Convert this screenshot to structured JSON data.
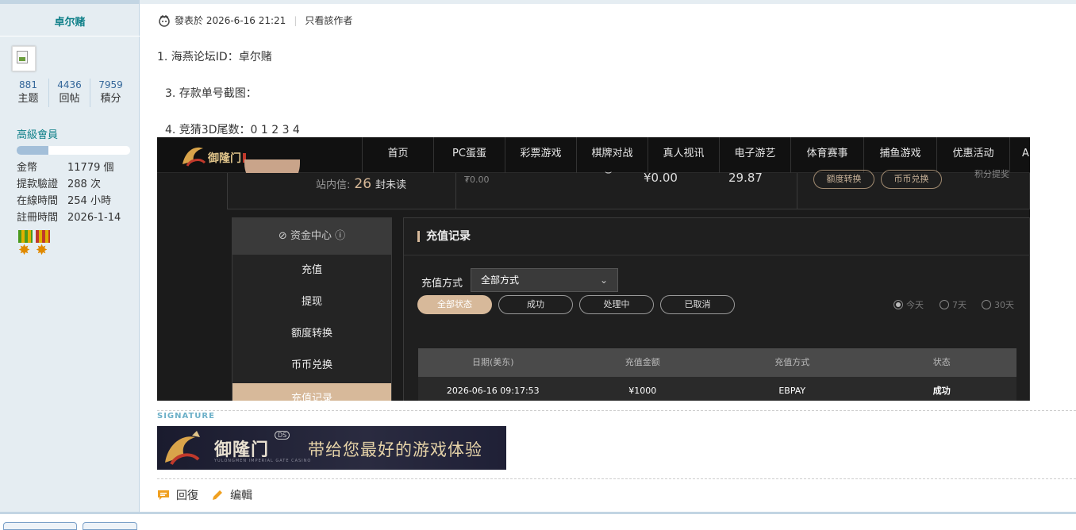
{
  "sidebar": {
    "username": "卓尔赌",
    "stats": [
      {
        "num": "881",
        "label": "主题"
      },
      {
        "num": "4436",
        "label": "回帖"
      },
      {
        "num": "7959",
        "label": "積分"
      }
    ],
    "rank": "高級會員",
    "rank_progress": 0.28,
    "info": [
      {
        "key": "金幣",
        "value": "11779 個"
      },
      {
        "key": "提款驗證",
        "value": "288 次"
      },
      {
        "key": "在線時間",
        "value": "254 小時"
      },
      {
        "key": "註冊時間",
        "value": "2026-1-14"
      }
    ]
  },
  "post": {
    "posted_label": "發表於 2026-6-16 21:21",
    "only_author": "只看該作者",
    "line1": "1. 海燕论坛ID：卓尔赌",
    "line3": "3. 存款单号截图：",
    "line4": "4. 竞猜3D尾数：0 1 2 3 4"
  },
  "screenshot": {
    "nav": [
      "首页",
      "PC蛋蛋",
      "彩票游戏",
      "棋牌对战",
      "真人视讯",
      "电子游艺",
      "体育赛事",
      "捕鱼游戏",
      "优惠活动",
      "A"
    ],
    "station_msg_label": "站内信:",
    "station_msg_count": "26",
    "station_msg_unread": "封未读",
    "currency_small": "₮0.00",
    "amount1": "¥0.00",
    "amount2": "29.87",
    "pill1": "额度转换",
    "pill2": "币币兑换",
    "points_text": "积分提奖",
    "menu_title": "资金中心",
    "menu_items": [
      "充值",
      "提现",
      "额度转换",
      "币币兑换",
      "充值记录"
    ],
    "panel_title": "充值记录",
    "filter_label": "充值方式",
    "filter_value": "全部方式",
    "status_tabs": [
      "全部状态",
      "成功",
      "处理中",
      "已取消"
    ],
    "range_options": [
      "今天",
      "7天",
      "30天"
    ],
    "table_headers": [
      "日期(美东)",
      "充值金额",
      "充值方式",
      "状态"
    ],
    "table_rows": [
      [
        "2026-06-16 09:17:53",
        "¥1000",
        "EBPAY",
        "成功"
      ]
    ]
  },
  "signature": {
    "label": "SIGNATURE",
    "brand": "御隆门",
    "brand_sub": "YULONGMEN IMPERIAL GATE CASINO",
    "brand_badge": "DS",
    "tagline": "带给您最好的游戏体验"
  },
  "actions": {
    "reply": "回復",
    "edit": "编輯"
  },
  "colors": {
    "accent_teal": "#0e7f88",
    "gold": "#d7b99a",
    "sidebar_bg": "#e5edf2"
  }
}
